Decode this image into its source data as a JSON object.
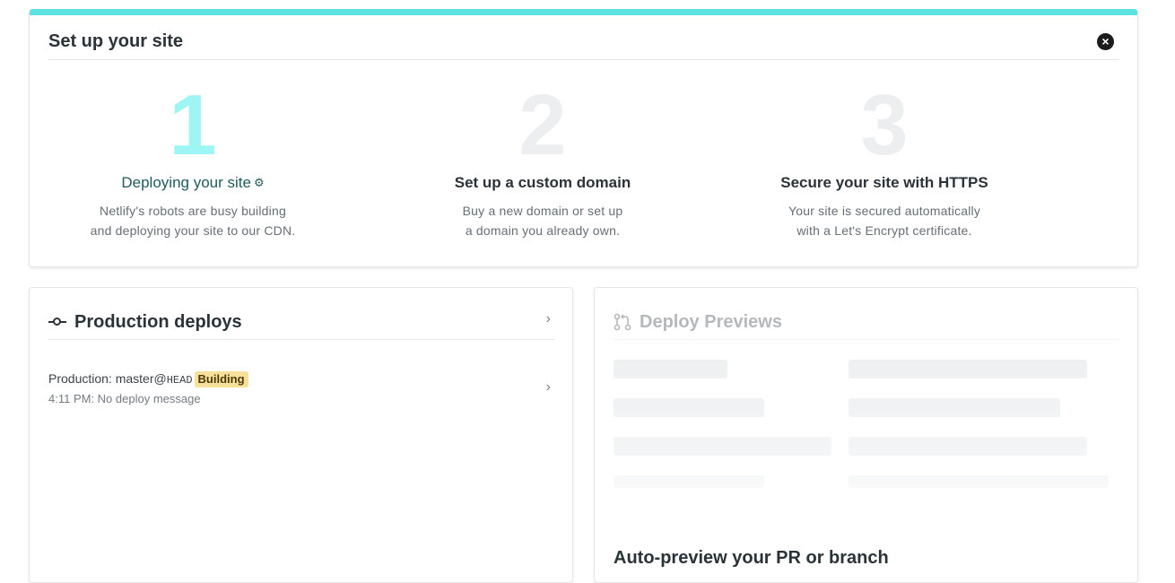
{
  "setup": {
    "title": "Set up your site",
    "close_icon": "×",
    "steps": [
      {
        "number": "1",
        "title": "Deploying your site",
        "desc1": "Netlify's robots are busy building",
        "desc2": "and deploying your site to our CDN."
      },
      {
        "number": "2",
        "title": "Set up a custom domain",
        "desc1": "Buy a new domain or set up",
        "desc2": "a domain you already own."
      },
      {
        "number": "3",
        "title": "Secure your site with HTTPS",
        "desc1": "Your site is secured automatically",
        "desc2": "with a Let's Encrypt certificate."
      }
    ]
  },
  "production": {
    "title": "Production deploys",
    "deploy": {
      "prefix": "Production: master@",
      "ref": "HEAD",
      "status": "Building",
      "meta": "4:11 PM: No deploy message"
    }
  },
  "previews": {
    "title": "Deploy Previews",
    "cta": "Auto-preview your PR or branch"
  },
  "colors": {
    "accent": "#5ee2e0",
    "active_number": "#9ef6f4",
    "badge": "#f6e09a"
  },
  "icons": {
    "close": "close-icon",
    "gear": "gear-icon",
    "commit": "commit-icon",
    "pull_request": "pull-request-icon",
    "chevron": "chevron-right-icon"
  }
}
